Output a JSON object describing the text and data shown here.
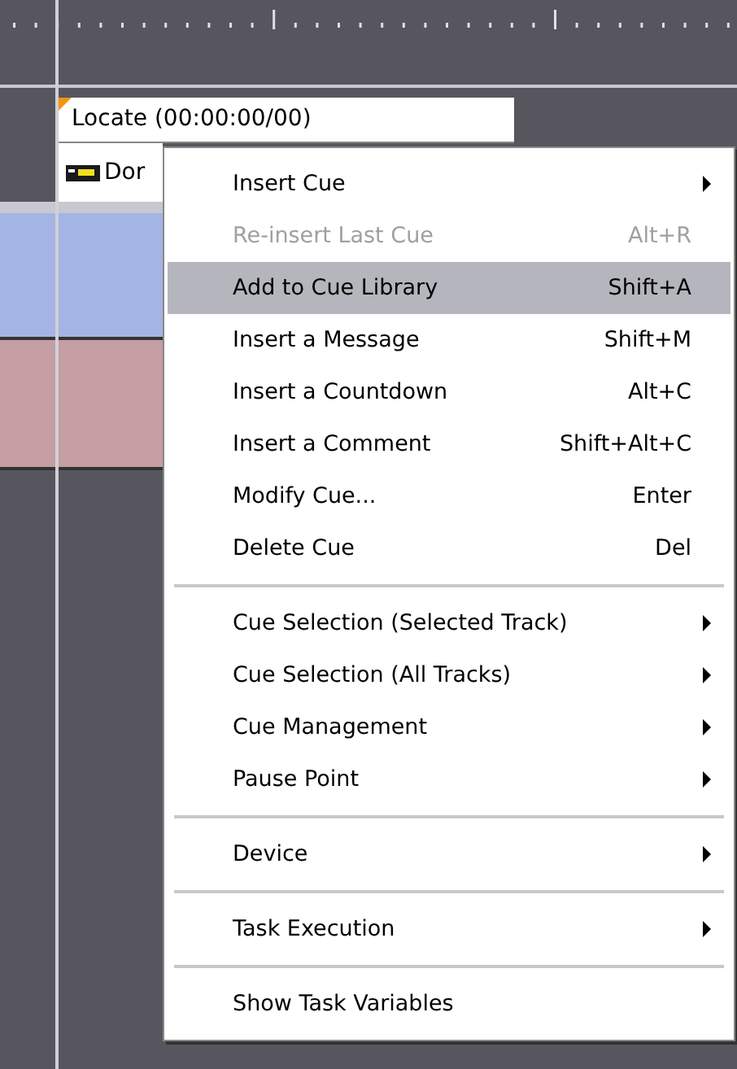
{
  "cue": {
    "label": "Locate (00:00:00/00)",
    "device_label": "Dor"
  },
  "menu": {
    "items": [
      {
        "kind": "item",
        "label": "Insert Cue",
        "submenu": true,
        "disabled": false,
        "selected": false
      },
      {
        "kind": "item",
        "label": "Re-insert Last Cue",
        "shortcut": "Alt+R",
        "submenu": false,
        "disabled": true,
        "selected": false
      },
      {
        "kind": "item",
        "label": "Add to Cue Library",
        "shortcut": "Shift+A",
        "submenu": false,
        "disabled": false,
        "selected": true
      },
      {
        "kind": "item",
        "label": "Insert a Message",
        "shortcut": "Shift+M",
        "submenu": false,
        "disabled": false,
        "selected": false
      },
      {
        "kind": "item",
        "label": "Insert a Countdown",
        "shortcut": "Alt+C",
        "submenu": false,
        "disabled": false,
        "selected": false
      },
      {
        "kind": "item",
        "label": "Insert a Comment",
        "shortcut": "Shift+Alt+C",
        "submenu": false,
        "disabled": false,
        "selected": false
      },
      {
        "kind": "item",
        "label": "Modify Cue...",
        "shortcut": "Enter",
        "submenu": false,
        "disabled": false,
        "selected": false
      },
      {
        "kind": "item",
        "label": "Delete Cue",
        "shortcut": "Del",
        "submenu": false,
        "disabled": false,
        "selected": false
      },
      {
        "kind": "separator"
      },
      {
        "kind": "item",
        "label": "Cue Selection (Selected Track)",
        "submenu": true,
        "disabled": false,
        "selected": false
      },
      {
        "kind": "item",
        "label": "Cue Selection (All Tracks)",
        "submenu": true,
        "disabled": false,
        "selected": false
      },
      {
        "kind": "item",
        "label": "Cue Management",
        "submenu": true,
        "disabled": false,
        "selected": false
      },
      {
        "kind": "item",
        "label": "Pause Point",
        "submenu": true,
        "disabled": false,
        "selected": false
      },
      {
        "kind": "separator"
      },
      {
        "kind": "item",
        "label": "Device",
        "submenu": true,
        "disabled": false,
        "selected": false
      },
      {
        "kind": "separator"
      },
      {
        "kind": "item",
        "label": "Task Execution",
        "submenu": true,
        "disabled": false,
        "selected": false
      },
      {
        "kind": "separator"
      },
      {
        "kind": "item",
        "label": "Show Task Variables",
        "submenu": false,
        "disabled": false,
        "selected": false
      }
    ]
  }
}
